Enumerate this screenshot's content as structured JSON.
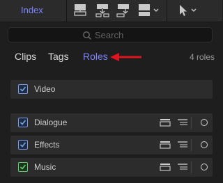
{
  "toolbar": {
    "index_label": "Index",
    "icons": [
      "connect-clip-icon",
      "insert-clip-icon",
      "append-clip-icon",
      "overwrite-clip-icon",
      "tool-select-icon"
    ]
  },
  "search": {
    "placeholder": "Search"
  },
  "tabs": [
    {
      "label": "Clips"
    },
    {
      "label": "Tags"
    },
    {
      "label": "Roles",
      "active": true
    }
  ],
  "roles_count": "4 roles",
  "roles": [
    {
      "label": "Video",
      "checked": true,
      "color": "#7aa0e0"
    },
    {
      "label": "Dialogue",
      "checked": true,
      "color": "#7aa0e0"
    },
    {
      "label": "Effects",
      "checked": true,
      "color": "#7aa0e0"
    },
    {
      "label": "Music",
      "checked": true,
      "color": "#5fd06a"
    }
  ],
  "colors": {
    "accent": "#7c83ff",
    "annotation_arrow": "#e0141e"
  }
}
